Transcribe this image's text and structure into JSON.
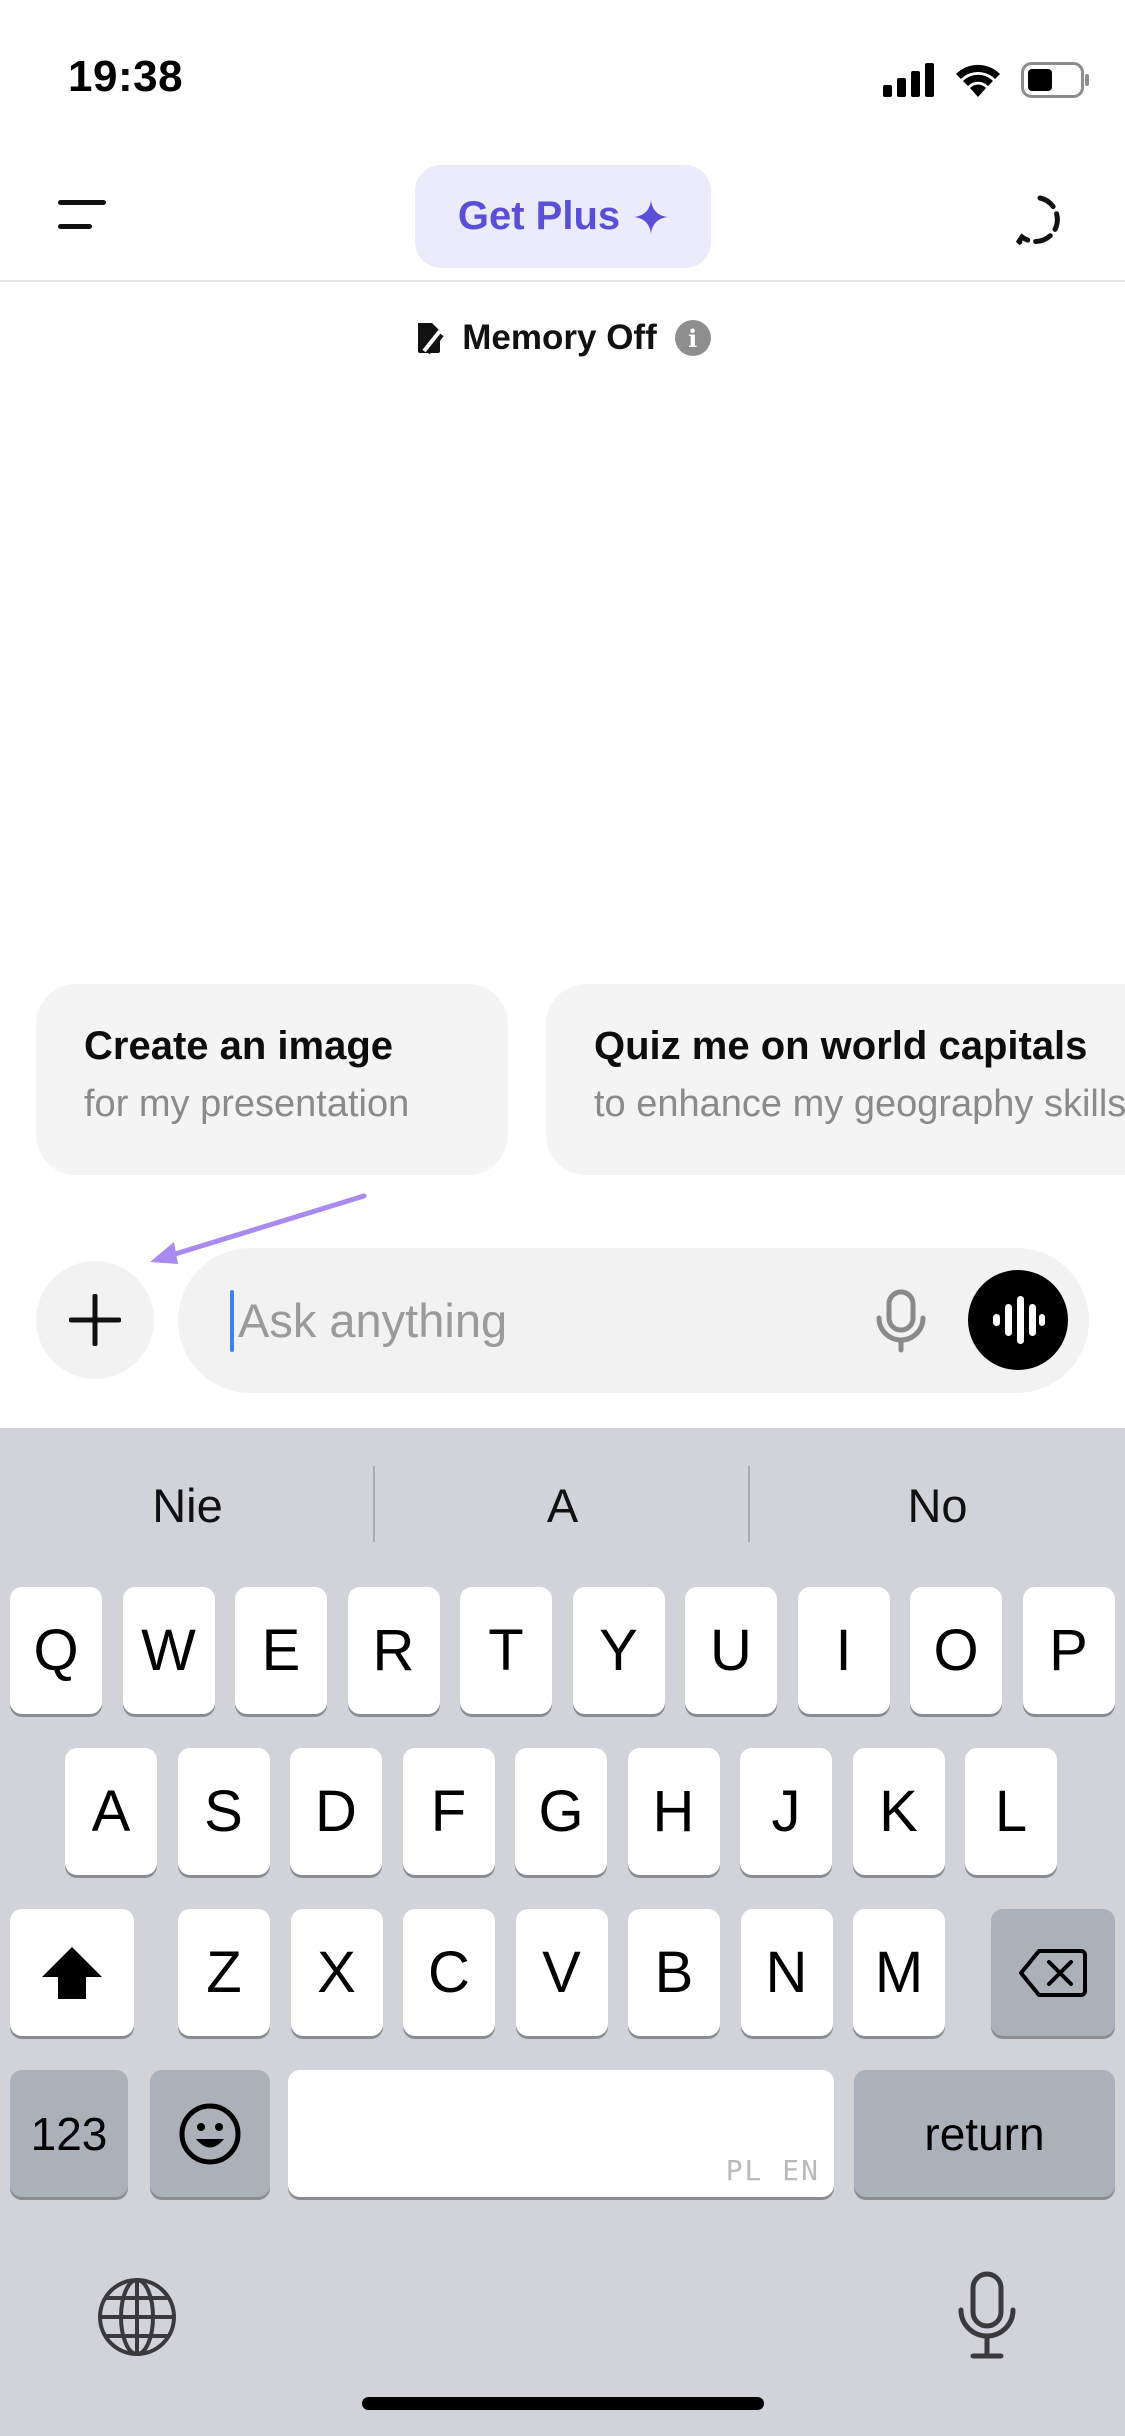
{
  "status_bar": {
    "time": "19:38",
    "icons": [
      "signal-icon",
      "wifi-icon",
      "battery-icon"
    ]
  },
  "header": {
    "menu_icon": "hamburger-menu-icon",
    "get_plus_label": "Get Plus",
    "get_plus_icon": "sparkle-icon",
    "new_chat_icon": "temporary-chat-icon"
  },
  "memory": {
    "label": "Memory Off",
    "icon": "memory-off-icon",
    "info_icon": "info-icon",
    "info_glyph": "i"
  },
  "suggestions": [
    {
      "title": "Create an image",
      "subtitle": "for my presentation"
    },
    {
      "title": "Quiz me on world capitals",
      "subtitle": "to enhance my geography skills"
    }
  ],
  "composer": {
    "placeholder": "Ask anything",
    "value": "",
    "plus_icon": "plus-icon",
    "mic_icon": "microphone-icon",
    "voice_icon": "voice-mode-icon"
  },
  "keyboard": {
    "suggestions": [
      "Nie",
      "A",
      "No"
    ],
    "row1": [
      "Q",
      "W",
      "E",
      "R",
      "T",
      "Y",
      "U",
      "I",
      "O",
      "P"
    ],
    "row2": [
      "A",
      "S",
      "D",
      "F",
      "G",
      "H",
      "J",
      "K",
      "L"
    ],
    "row3": [
      "Z",
      "X",
      "C",
      "V",
      "B",
      "N",
      "M"
    ],
    "numbers_label": "123",
    "space_tag": "PL EN",
    "return_label": "return",
    "emoji_icon": "emoji-icon",
    "globe_icon": "globe-icon",
    "dictation_icon": "microphone-icon",
    "shift_icon": "shift-icon",
    "delete_icon": "delete-icon"
  },
  "colors": {
    "accent": "#5a4fd6",
    "pill_bg": "#ecebfb",
    "annotation_arrow": "#a98af0",
    "keyboard_bg": "#d1d3d9"
  }
}
